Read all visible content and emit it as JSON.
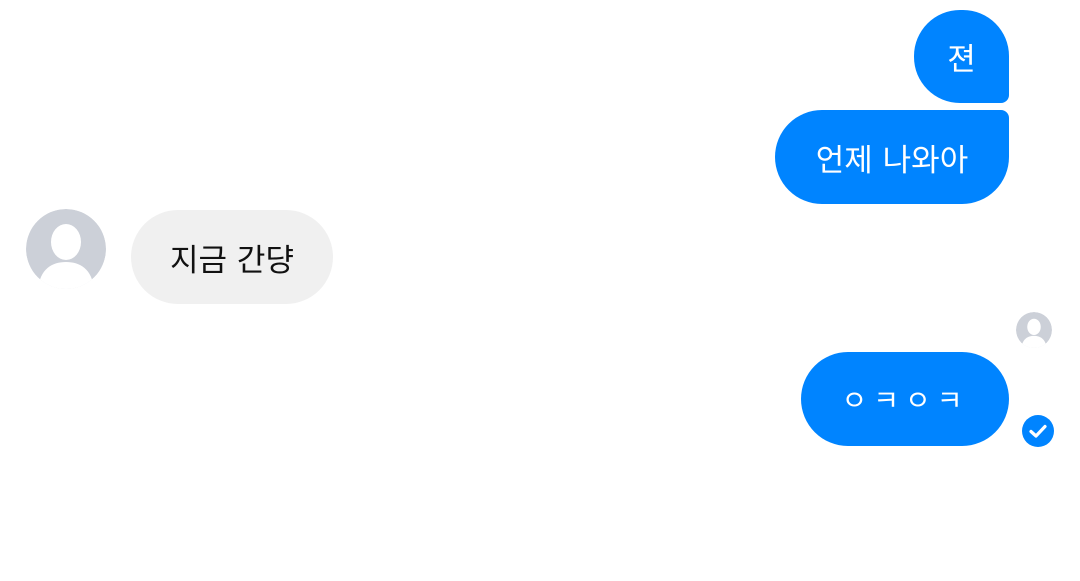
{
  "messages": [
    {
      "id": "msg1",
      "direction": "outgoing",
      "text": "젼"
    },
    {
      "id": "msg2",
      "direction": "outgoing",
      "text": "언제 나와아"
    },
    {
      "id": "msg3",
      "direction": "incoming",
      "text": "지금 간댱"
    },
    {
      "id": "msg4",
      "direction": "outgoing",
      "text": "ㅇㅋㅇㅋ"
    }
  ],
  "avatars": {
    "contact": "default-user-avatar",
    "seen_receipt": "default-user-avatar"
  },
  "status": {
    "last_message_icon": "checkmark-circle-icon"
  },
  "colors": {
    "outgoing_bubble": "#0084ff",
    "incoming_bubble": "#f0f0f0",
    "avatar_bg": "#ccd0d8",
    "avatar_fg": "#ffffff"
  }
}
